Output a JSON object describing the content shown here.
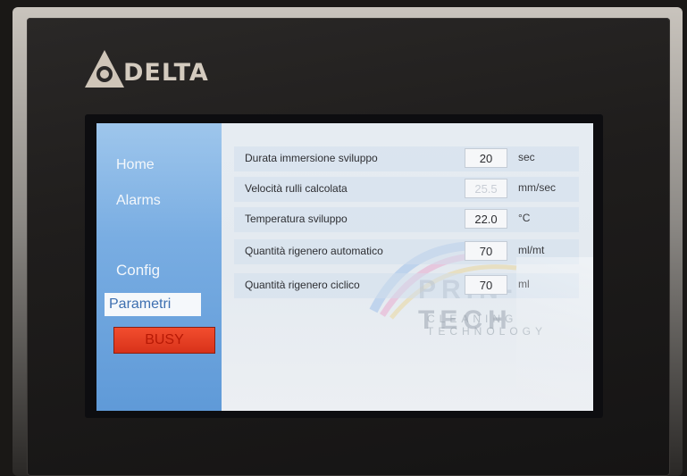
{
  "brand": {
    "name": "DELTA"
  },
  "nav": {
    "home": "Home",
    "alarms": "Alarms",
    "config": "Config",
    "active": "Parametri"
  },
  "status_button": {
    "label": "BUSY"
  },
  "params": [
    {
      "label": "Durata immersione sviluppo",
      "value": "20",
      "unit": "sec"
    },
    {
      "label": "Velocità rulli calcolata",
      "value": "25.5",
      "unit": "mm/sec"
    },
    {
      "label": "Temperatura sviluppo",
      "value": "22.0",
      "unit": "°C"
    },
    {
      "label": "Quantità rigenero automatico",
      "value": "70",
      "unit": "ml/mt"
    },
    {
      "label": "Quantità rigenero ciclico",
      "value": "70",
      "unit": "ml"
    }
  ],
  "watermark": {
    "title": "PRIN-TECH",
    "subtitle": "CLEANING TECHNOLOGY"
  },
  "colors": {
    "sidebar": "#79ade2",
    "busy": "#e23a20",
    "brand": "#d4cbbf"
  }
}
